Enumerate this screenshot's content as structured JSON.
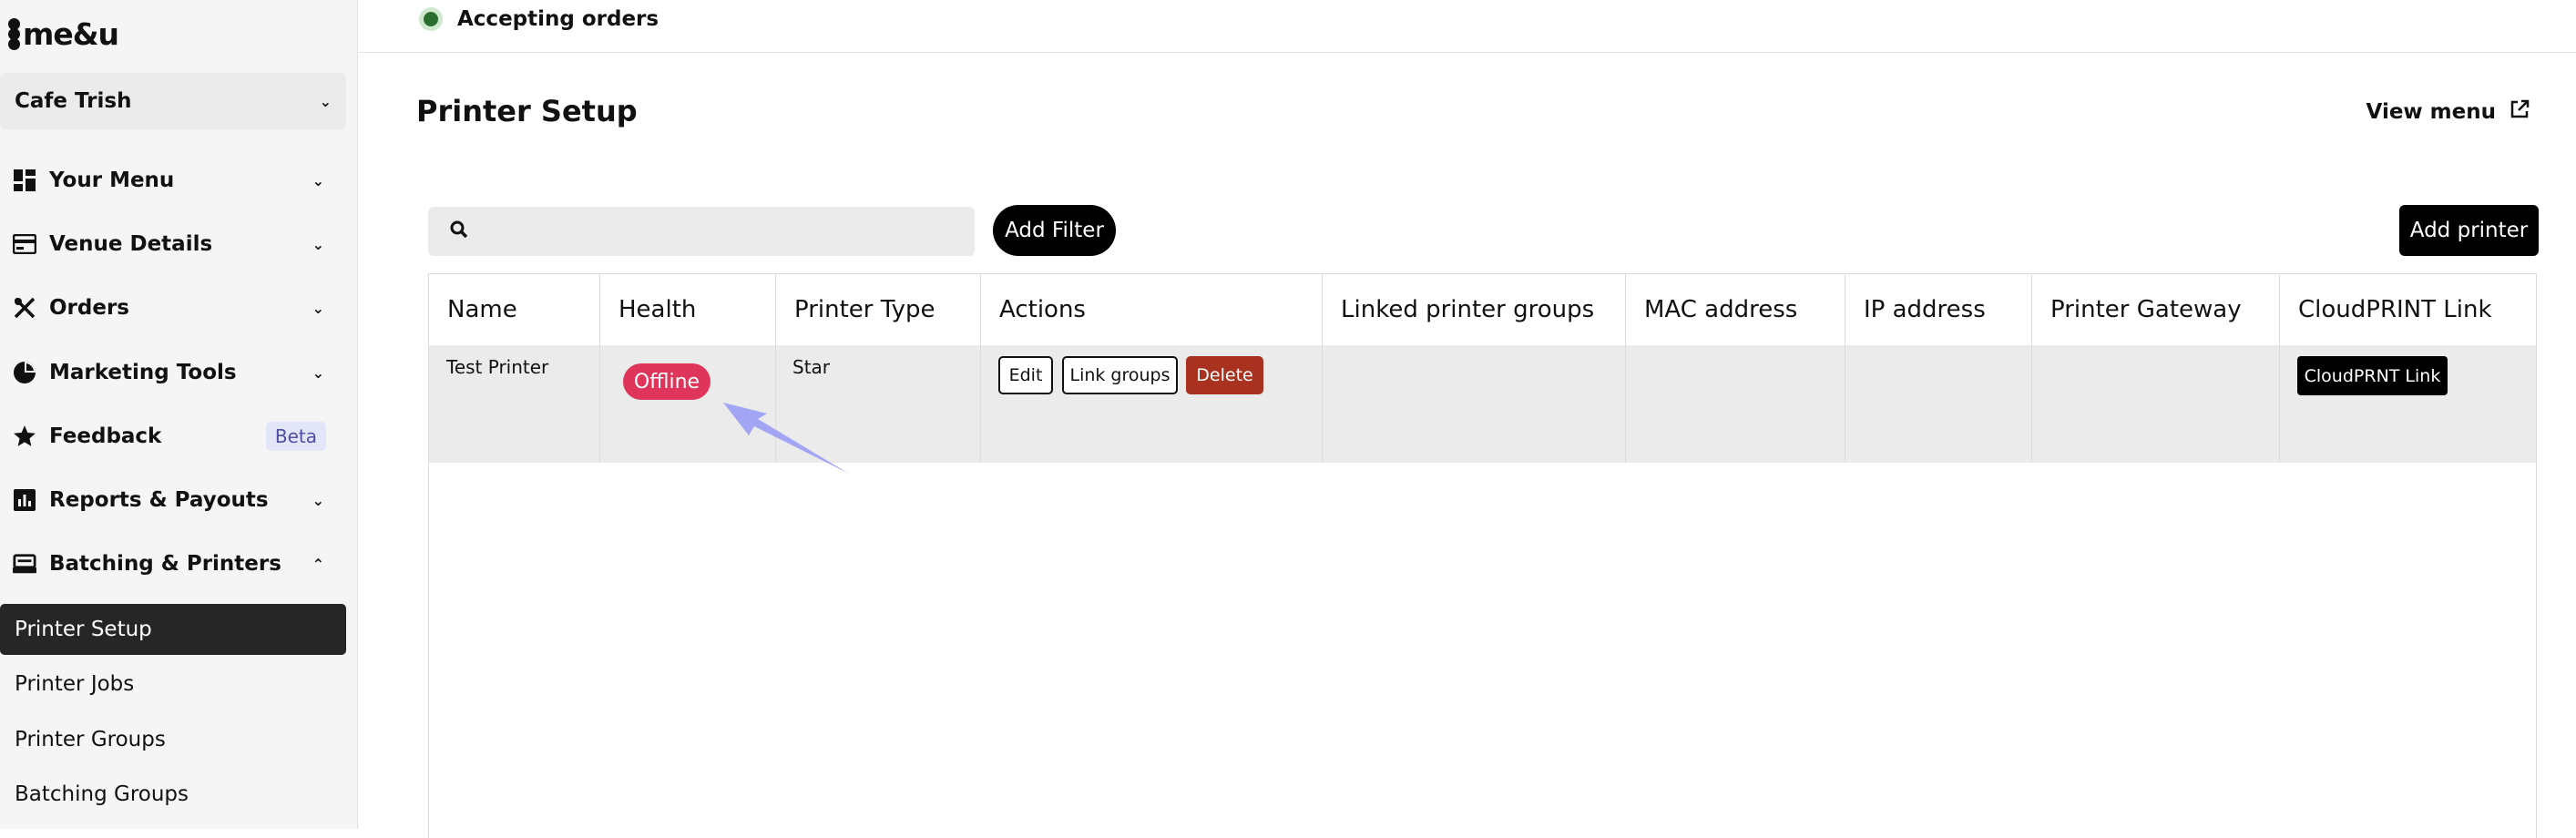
{
  "brand": {
    "logo_text": "me&u"
  },
  "venue": {
    "name": "Cafe Trish"
  },
  "sidebar": {
    "items": [
      {
        "label": "Your Menu",
        "icon": "grid-icon"
      },
      {
        "label": "Venue Details",
        "icon": "card-icon"
      },
      {
        "label": "Orders",
        "icon": "utensils-icon"
      },
      {
        "label": "Marketing Tools",
        "icon": "pie-chart-icon"
      },
      {
        "label": "Feedback",
        "icon": "star-icon",
        "badge": "Beta"
      },
      {
        "label": "Reports & Payouts",
        "icon": "bar-chart-icon"
      },
      {
        "label": "Batching & Printers",
        "icon": "printer-icon"
      }
    ],
    "sub_items": [
      "Printer Setup",
      "Printer Jobs",
      "Printer Groups",
      "Batching Groups"
    ]
  },
  "topbar": {
    "status": "Accepting orders",
    "status_color": "#2b6d2f"
  },
  "page": {
    "title": "Printer Setup",
    "view_menu": "View menu"
  },
  "toolbar": {
    "search_placeholder": "",
    "add_filter": "Add Filter",
    "add_printer": "Add printer"
  },
  "table": {
    "columns": [
      "Name",
      "Health",
      "Printer Type",
      "Actions",
      "Linked printer groups",
      "MAC address",
      "IP address",
      "Printer Gateway",
      "CloudPRINT Link"
    ],
    "rows": [
      {
        "name": "Test Printer",
        "health": "Offline",
        "printer_type": "Star",
        "actions": {
          "edit": "Edit",
          "link_groups": "Link groups",
          "delete": "Delete"
        },
        "linked_groups": "",
        "mac": "",
        "ip": "",
        "gateway": "",
        "cloudprint": "CloudPRNT Link"
      }
    ]
  },
  "colors": {
    "offline": "#e0355a",
    "delete": "#a8321f",
    "arrow": "#9a9cf5",
    "beta_bg": "#e3e6f8"
  }
}
